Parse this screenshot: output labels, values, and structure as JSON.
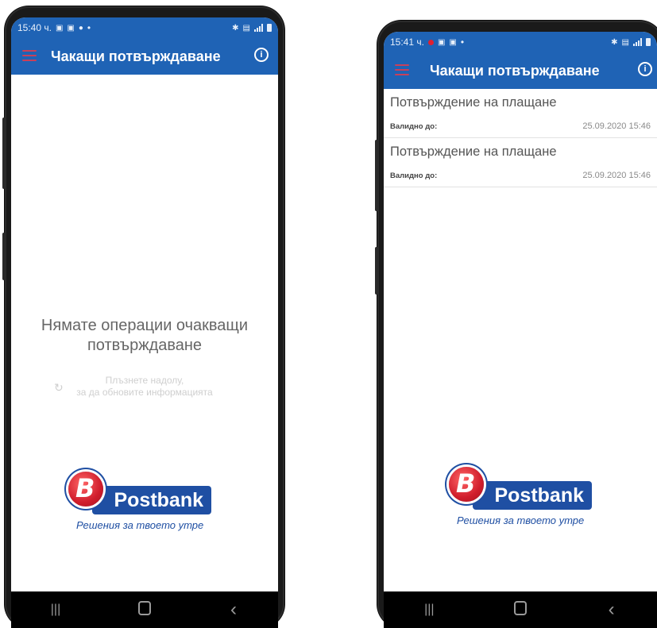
{
  "left_phone": {
    "status": {
      "time": "15:40 ч.",
      "dot": "•"
    },
    "appbar": {
      "title": "Чакащи потвърждаване",
      "info": "i"
    },
    "empty_message": "Нямате операции очакващи потвърждаване",
    "pull_hint_line1": "Плъзнете надолу,",
    "pull_hint_line2": "за да обновите информацията",
    "logo": {
      "brand": "Postbank",
      "tagline": "Решения за твоето утре",
      "badge": "B"
    },
    "nav": {
      "recents": "|||",
      "back": "‹"
    }
  },
  "right_phone": {
    "status": {
      "time": "15:41 ч.",
      "dot": "•"
    },
    "appbar": {
      "title": "Чакащи потвърждаване",
      "info": "i"
    },
    "items": [
      {
        "title": "Потвърждение на плащане",
        "label": "Валидно до:",
        "date": "25.09.2020 15:46"
      },
      {
        "title": "Потвърждение на плащане",
        "label": "Валидно до:",
        "date": "25.09.2020 15:46"
      }
    ],
    "logo": {
      "brand": "Postbank",
      "tagline": "Решения за твоето утре",
      "badge": "B"
    },
    "nav": {
      "recents": "|||",
      "back": "‹"
    }
  },
  "colors": {
    "primary": "#1f63b5",
    "logo_blue": "#1f4fa3",
    "logo_red": "#d01d2c",
    "menu_accent": "#c8405a"
  },
  "icons": [
    "menu-icon",
    "info-icon",
    "refresh-icon",
    "bluetooth-icon",
    "signal-icon",
    "battery-icon"
  ]
}
